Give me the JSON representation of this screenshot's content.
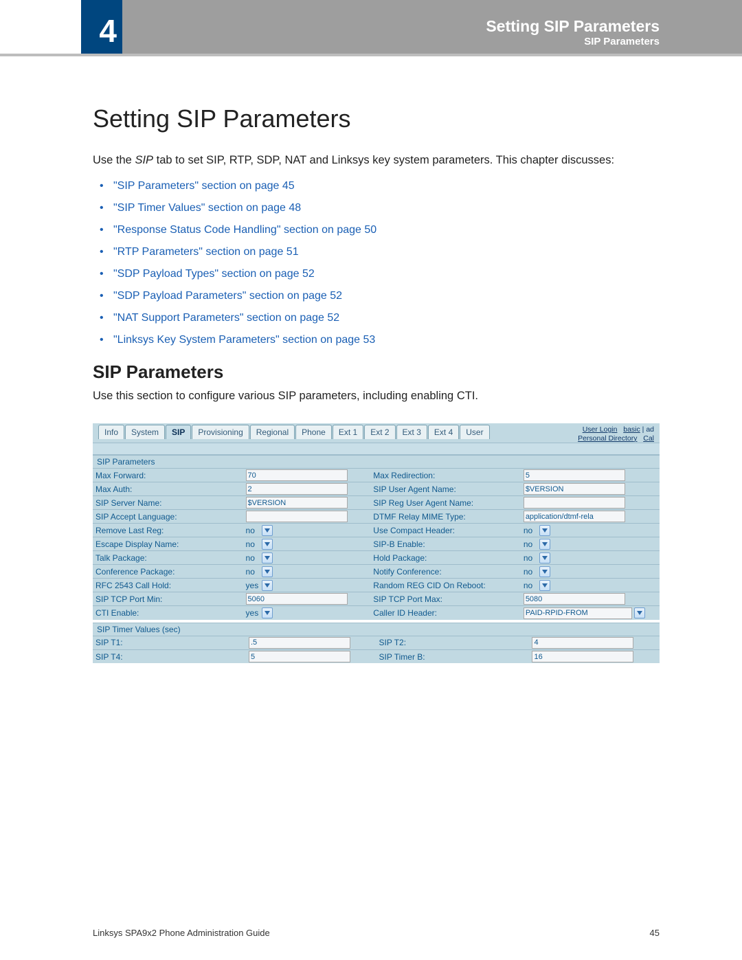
{
  "chapter_number": "4",
  "header_title": "Setting SIP Parameters",
  "header_subtitle": "SIP Parameters",
  "page_title": "Setting SIP Parameters",
  "lead_pre": "Use the ",
  "lead_italic": "SIP",
  "lead_post": " tab to set SIP, RTP, SDP, NAT and Linksys key system parameters. This chapter discusses:",
  "toc": [
    "\"SIP Parameters\" section on page 45",
    "\"SIP Timer Values\" section on page 48",
    "\"Response Status Code Handling\" section on page 50",
    "\"RTP Parameters\" section on page 51",
    "\"SDP Payload Types\" section on page 52",
    "\"SDP Payload Parameters\" section on page 52",
    "\"NAT Support Parameters\" section on page 52",
    "\"Linksys Key System Parameters\" section on page 53"
  ],
  "section_title": "SIP Parameters",
  "section_lead": "Use this section to configure various SIP parameters, including enabling CTI.",
  "shot": {
    "tabs": [
      "Info",
      "System",
      "SIP",
      "Provisioning",
      "Regional",
      "Phone",
      "Ext 1",
      "Ext 2",
      "Ext 3",
      "Ext 4",
      "User"
    ],
    "active_tab_index": 2,
    "rightlinks_line1_a": "User Login",
    "rightlinks_line1_b": "basic",
    "rightlinks_line1_c": "| ad",
    "rightlinks_line2_a": "Personal Directory",
    "rightlinks_line2_b": "Cal",
    "group1_title": "SIP Parameters",
    "rows1": [
      {
        "l1": "Max Forward:",
        "t1": "text",
        "v1": "70",
        "l2": "Max Redirection:",
        "t2": "text",
        "v2": "5"
      },
      {
        "l1": "Max Auth:",
        "t1": "text",
        "v1": "2",
        "l2": "SIP User Agent Name:",
        "t2": "text",
        "v2": "$VERSION"
      },
      {
        "l1": "SIP Server Name:",
        "t1": "text",
        "v1": "$VERSION",
        "l2": "SIP Reg User Agent Name:",
        "t2": "text",
        "v2": ""
      },
      {
        "l1": "SIP Accept Language:",
        "t1": "text",
        "v1": "",
        "l2": "DTMF Relay MIME Type:",
        "t2": "text",
        "v2": "application/dtmf-rela"
      },
      {
        "l1": "Remove Last Reg:",
        "t1": "sel",
        "v1": "no",
        "l2": "Use Compact Header:",
        "t2": "sel",
        "v2": "no"
      },
      {
        "l1": "Escape Display Name:",
        "t1": "sel",
        "v1": "no",
        "l2": "SIP-B Enable:",
        "t2": "sel",
        "v2": "no"
      },
      {
        "l1": "Talk Package:",
        "t1": "sel",
        "v1": "no",
        "l2": "Hold Package:",
        "t2": "sel",
        "v2": "no"
      },
      {
        "l1": "Conference Package:",
        "t1": "sel",
        "v1": "no",
        "l2": "Notify Conference:",
        "t2": "sel",
        "v2": "no"
      },
      {
        "l1": "RFC 2543 Call Hold:",
        "t1": "sel",
        "v1": "yes",
        "l2": "Random REG CID On Reboot:",
        "t2": "sel",
        "v2": "no"
      },
      {
        "l1": "SIP TCP Port Min:",
        "t1": "text",
        "v1": "5060",
        "l2": "SIP TCP Port Max:",
        "t2": "text",
        "v2": "5080"
      },
      {
        "l1": "CTI Enable:",
        "t1": "sel",
        "v1": "yes",
        "l2": "Caller ID Header:",
        "t2": "selwide",
        "v2": "PAID-RPID-FROM"
      }
    ],
    "group2_title": "SIP Timer Values (sec)",
    "rows2": [
      {
        "l1": "SIP T1:",
        "t1": "text",
        "v1": ".5",
        "l2": "SIP T2:",
        "t2": "text",
        "v2": "4"
      },
      {
        "l1": "SIP T4:",
        "t1": "text",
        "v1": "5",
        "l2": "SIP Timer B:",
        "t2": "text",
        "v2": "16"
      }
    ]
  },
  "footer_left": "Linksys SPA9x2 Phone Administration Guide",
  "footer_right": "45"
}
